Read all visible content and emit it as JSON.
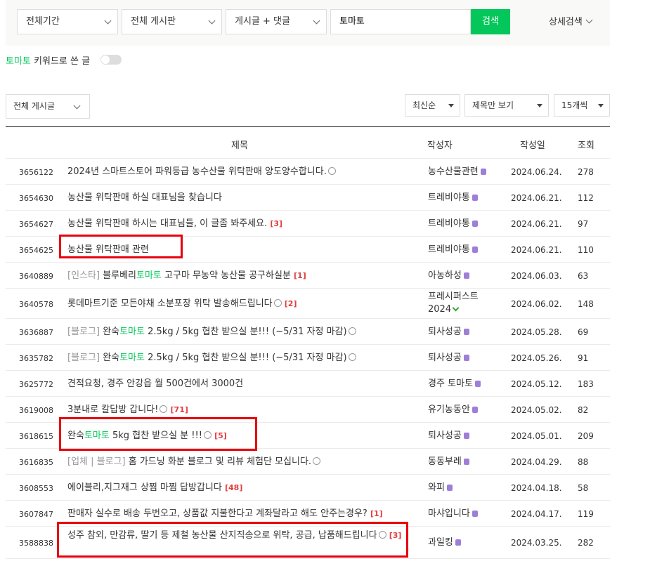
{
  "search": {
    "period": "전체기간",
    "board": "전체 게시판",
    "scope": "게시글 + 댓글",
    "keyword": "토마토",
    "button": "검색",
    "advanced": "상세검색"
  },
  "keyword_filter": {
    "keyword": "토마토",
    "suffix": " 키워드로 쓴 글"
  },
  "list_filters": {
    "board_filter": "전체 게시글",
    "sort": "최신순",
    "view_mode": "제목만 보기",
    "per_page": "15개씩"
  },
  "columns": {
    "title": "제목",
    "author": "작성자",
    "date": "작성일",
    "views": "조회"
  },
  "rows": [
    {
      "num": "3656122",
      "prefix": "",
      "title_a": "2024년 스마트스토어 파워등급 농수산물 위탁판매 양도양수합니다.",
      "hl": "",
      "title_b": "",
      "comments": "",
      "author": "농수산물관련",
      "author2": "",
      "date": "2024.06.24.",
      "views": "278"
    },
    {
      "num": "3654630",
      "prefix": "",
      "title_a": "농산물 위탁판매 하실 대표님을 찾습니다",
      "hl": "",
      "title_b": "",
      "comments": "",
      "author": "트레비야통",
      "author2": "",
      "date": "2024.06.21.",
      "views": "112"
    },
    {
      "num": "3654627",
      "prefix": "",
      "title_a": "농산물 위탁판매 하시는 대표님들, 이 글좀 봐주세요.",
      "hl": "",
      "title_b": "",
      "comments": "[3]",
      "author": "트레비야통",
      "author2": "",
      "date": "2024.06.21.",
      "views": "97"
    },
    {
      "num": "3654625",
      "prefix": "",
      "title_a": "농산물 위탁판매 관련",
      "hl": "",
      "title_b": "",
      "comments": "",
      "author": "트레비야통",
      "author2": "",
      "date": "2024.06.21.",
      "views": "110"
    },
    {
      "num": "3640889",
      "prefix": "[인스타]",
      "title_a": "블루베리",
      "hl": "토마토",
      "title_b": "고구마 무농약 농산물 공구하실분",
      "comments": "[1]",
      "author": "아농하성",
      "author2": "",
      "date": "2024.06.03.",
      "views": "63"
    },
    {
      "num": "3640578",
      "prefix": "",
      "title_a": "롯데마트기준 모든야채 소분포장 위탁 발송해드립니다",
      "hl": "",
      "title_b": "",
      "comments": "[2]",
      "author": "프레시퍼스트",
      "author2": "2024",
      "date": "2024.06.02.",
      "views": "148"
    },
    {
      "num": "3636887",
      "prefix": "[블로그]",
      "title_a": "완숙",
      "hl": "토마토",
      "title_b": "2.5kg / 5kg 협찬 받으실 분!!! (~5/31 자정 마감)",
      "comments": "",
      "author": "퇴사성공",
      "author2": "",
      "date": "2024.05.28.",
      "views": "69"
    },
    {
      "num": "3635782",
      "prefix": "[블로그]",
      "title_a": "완숙",
      "hl": "토마토",
      "title_b": "2.5kg / 5kg 협찬 받으실 분!!! (~5/31 자정 마감)",
      "comments": "",
      "author": "퇴사성공",
      "author2": "",
      "date": "2024.05.26.",
      "views": "91"
    },
    {
      "num": "3625772",
      "prefix": "",
      "title_a": "견적요청, 경주 안강읍 월 500건에서 3000건",
      "hl": "",
      "title_b": "",
      "comments": "",
      "author": "경주 토마토",
      "author2": "",
      "date": "2024.05.12.",
      "views": "183"
    },
    {
      "num": "3619008",
      "prefix": "",
      "title_a": "3분내로 칼답방 갑니다!",
      "hl": "",
      "title_b": "",
      "comments": "[71]",
      "author": "유기농동안",
      "author2": "",
      "date": "2024.05.02.",
      "views": "82"
    },
    {
      "num": "3618615",
      "prefix": "",
      "title_a": "완숙",
      "hl": "토마토",
      "title_b": "5kg 협찬 받으실 분 !!!",
      "comments": "[5]",
      "author": "퇴사성공",
      "author2": "",
      "date": "2024.05.01.",
      "views": "209"
    },
    {
      "num": "3616835",
      "prefix": "[업체 | 블로그]",
      "title_a": "홈 가드닝 화분 블로그 및 리뷰 체험단 모십니다.",
      "hl": "",
      "title_b": "",
      "comments": "",
      "author": "동동부레",
      "author2": "",
      "date": "2024.04.29.",
      "views": "88"
    },
    {
      "num": "3608553",
      "prefix": "",
      "title_a": "에이블리,지그재그 상찜 마찜 답방갑니다",
      "hl": "",
      "title_b": "",
      "comments": "[48]",
      "author": "와피",
      "author2": "",
      "date": "2024.04.18.",
      "views": "58"
    },
    {
      "num": "3607847",
      "prefix": "",
      "title_a": "판매자 실수로 배송 두번오고, 상품값 지불한다고 계좌달라고 해도 안주는경우?",
      "hl": "",
      "title_b": "",
      "comments": "[1]",
      "author": "마샤입니다",
      "author2": "",
      "date": "2024.04.17.",
      "views": "119"
    },
    {
      "num": "3588838",
      "prefix": "",
      "title_a": "성주 참외, 만감류, 딸기 등 제철 농산물 산지직송으로 위탁, 공급, 납품해드립니다",
      "hl": "",
      "title_b": "",
      "comments": "[3]",
      "author": "과일킹",
      "author2": "",
      "date": "2024.03.25.",
      "views": "282"
    }
  ]
}
